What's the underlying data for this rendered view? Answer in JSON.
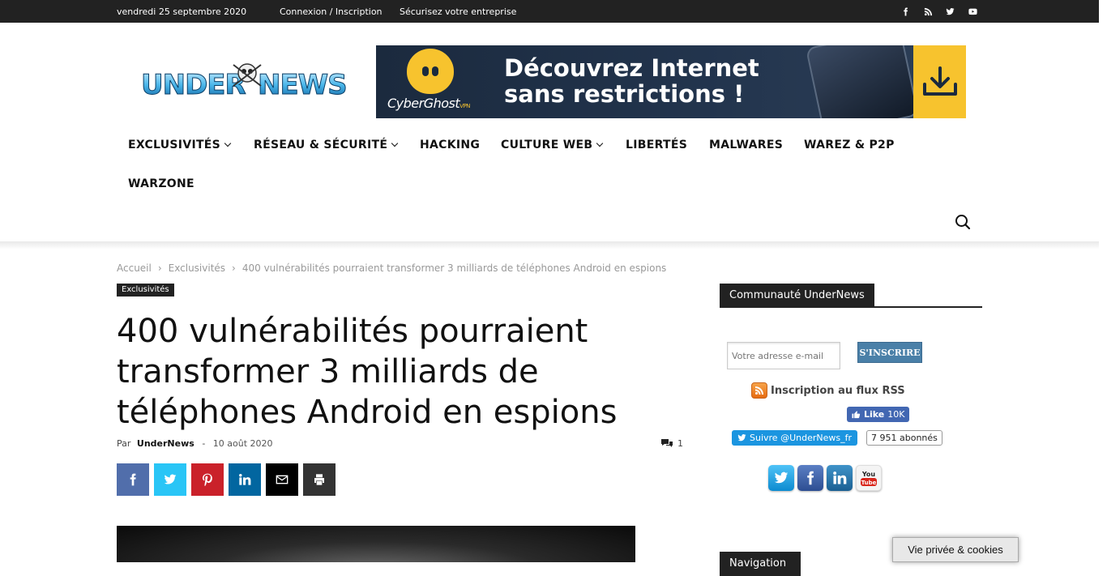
{
  "topbar": {
    "date": "vendredi 25 septembre 2020",
    "login": "Connexion / Inscription",
    "secure": "Sécurisez votre entreprise",
    "social_icons": [
      "facebook-icon",
      "rss-icon",
      "twitter-icon",
      "youtube-icon"
    ]
  },
  "logo": {
    "text": "UnderNews"
  },
  "banner": {
    "brand": "CyberGhost",
    "brand_suffix": "VPN",
    "headline_line1": "Découvrez Internet",
    "headline_line2": "sans restrictions !",
    "accent_color": "#f7c32e"
  },
  "nav": {
    "items": [
      {
        "label": "EXCLUSIVITÉS",
        "has_dropdown": true
      },
      {
        "label": "RÉSEAU & SÉCURITÉ",
        "has_dropdown": true
      },
      {
        "label": "HACKING",
        "has_dropdown": false
      },
      {
        "label": "CULTURE WEB",
        "has_dropdown": true
      },
      {
        "label": "LIBERTÉS",
        "has_dropdown": false
      },
      {
        "label": "MALWARES",
        "has_dropdown": false
      },
      {
        "label": "WAREZ & P2P",
        "has_dropdown": false
      },
      {
        "label": "WARZONE",
        "has_dropdown": false
      }
    ]
  },
  "breadcrumb": {
    "home": "Accueil",
    "category": "Exclusivités",
    "current": "400 vulnérabilités pourraient transformer 3 milliards de téléphones Android en espions"
  },
  "article": {
    "category": "Exclusivités",
    "title": "400 vulnérabilités pourraient transformer 3 milliards de téléphones Android en espions",
    "by": "Par",
    "author": "UnderNews",
    "dash": "-",
    "date": "10 août 2020",
    "comments": "1"
  },
  "share": {
    "buttons": [
      {
        "name": "facebook",
        "color": "#516eab"
      },
      {
        "name": "twitter",
        "color": "#29c5f6"
      },
      {
        "name": "pinterest",
        "color": "#ca212a"
      },
      {
        "name": "linkedin",
        "color": "#0266a0"
      },
      {
        "name": "email",
        "color": "#000000"
      },
      {
        "name": "print",
        "color": "#333333"
      }
    ]
  },
  "sidebar": {
    "community_title": "Communauté UnderNews",
    "email_placeholder": "Votre adresse e-mail",
    "subscribe_label": "S'INSCRIRE",
    "rss_label": "Inscription au flux RSS",
    "fb_like_label": "Like",
    "fb_like_count": "10K",
    "twitter_follow": "Suivre @UnderNews_fr",
    "twitter_count": "7 951 abonnés",
    "nav_title": "Navigation"
  },
  "cookie": {
    "label": "Vie privée & cookies"
  }
}
